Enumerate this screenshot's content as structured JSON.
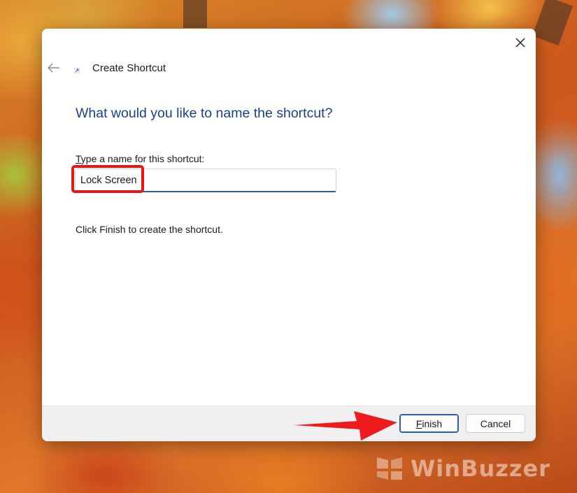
{
  "dialog": {
    "title": "Create Shortcut",
    "heading": "What would you like to name the shortcut?",
    "field_label_accel": "T",
    "field_label_rest": "ype a name for this shortcut:",
    "name_value": "Lock Screen",
    "hint": "Click Finish to create the shortcut."
  },
  "footer": {
    "finish_accel": "F",
    "finish_rest": "inish",
    "cancel_label": "Cancel"
  },
  "watermark": {
    "text": "WinBuzzer"
  },
  "colors": {
    "heading": "#1d3f8c",
    "accent": "#2a5db0",
    "highlight": "#e01818"
  },
  "icons": [
    "close-icon",
    "back-arrow-icon",
    "shortcut-icon",
    "red-pointer-arrow",
    "winbuzzer-logo-icon"
  ]
}
